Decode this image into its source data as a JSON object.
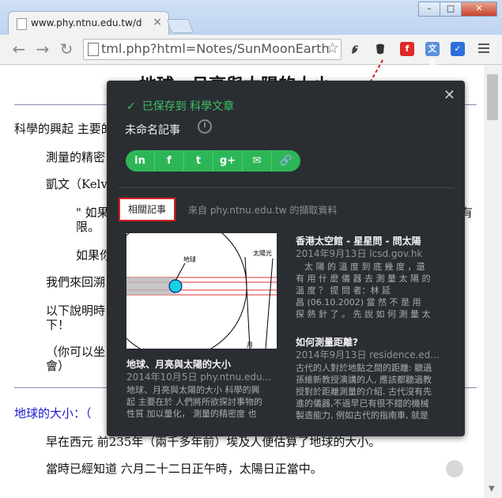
{
  "browser": {
    "tab_title": "www.phy.ntnu.edu.tw/de",
    "tab_close": "×",
    "window_buttons": [
      "–",
      "□",
      "✕"
    ],
    "url": "tml.php?html=Notes/SunMoonEarth",
    "nav_icons": [
      "back-icon",
      "forward-icon",
      "reload-icon",
      "star-icon"
    ],
    "extensions": [
      "evernote-elephant-icon",
      "evernote-clipper-icon",
      "flipboard-icon",
      "translate-icon",
      "checkmark-icon",
      "menu-icon"
    ]
  },
  "page": {
    "heading": "地球、月亮與太陽的大小",
    "paragraphs": [
      "科學的興起 主要的",
      "測量的精密",
      "凱文（Kelv",
      "\" 如果",
      "限。",
      "如果你",
      "我們來回溯",
      "以下說明時",
      "下！",
      "（你可以坐",
      "會）"
    ],
    "right_fragment": "有",
    "section_title": "地球的大小：（",
    "line_235": "早在西元 前235年（兩千多年前）埃及人便估算了地球的大小。",
    "line_sun": "當時已經知道 六月二十二日正午時，太陽日正當中。"
  },
  "clipper": {
    "saved_text": "已保存到 科學文章",
    "note_title": "未命名記事",
    "share_buttons": [
      "in",
      "f",
      "t",
      "g+",
      "✉",
      "🔗"
    ],
    "related_label": "相關記事",
    "source_text": "來自 phy.ntnu.edu.tw 的擷取資料",
    "cards": [
      {
        "title": "地球、月亮與太陽的大小",
        "meta": "2014年10月5日   phy.ntnu.edu...",
        "body": [
          "地球、月亮與太陽的大小 科學的興",
          "起 主要在於 人們將所欲探討事物的",
          "性質 加以量化， 測量的精密度 也"
        ],
        "thumb_labels": [
          "地球",
          "太陽光",
          "月"
        ]
      },
      {
        "title": "香港太空館 - 星星問 - 問太陽",
        "meta": "2014年9月13日   lcsd.gov.hk",
        "body": [
          "　太 陽 的 溫 度 到 底 幾 度 ，還",
          "有 用 什 麼 儀 器 去 測 量 太 陽 的",
          "溫 度 ？ 提 問 者：林 延",
          "昌 (06.10.2002) 當 然 不 是 用",
          "探 熱 針 了 。 先 說 如 何 測 量 太"
        ]
      },
      {
        "title": "如何測量距離?",
        "meta": "2014年9月13日   residence.ed...",
        "body": [
          "古代的人對於地點之間的距離: 聽過",
          "孫維新教授演講的人, 應該都聽過教",
          "授對於距離測量的介紹. 古代沒有先",
          "進的儀器,不過早已有很不錯的機械",
          "製造能力, 例如古代的指南車, 就是"
        ]
      }
    ]
  }
}
